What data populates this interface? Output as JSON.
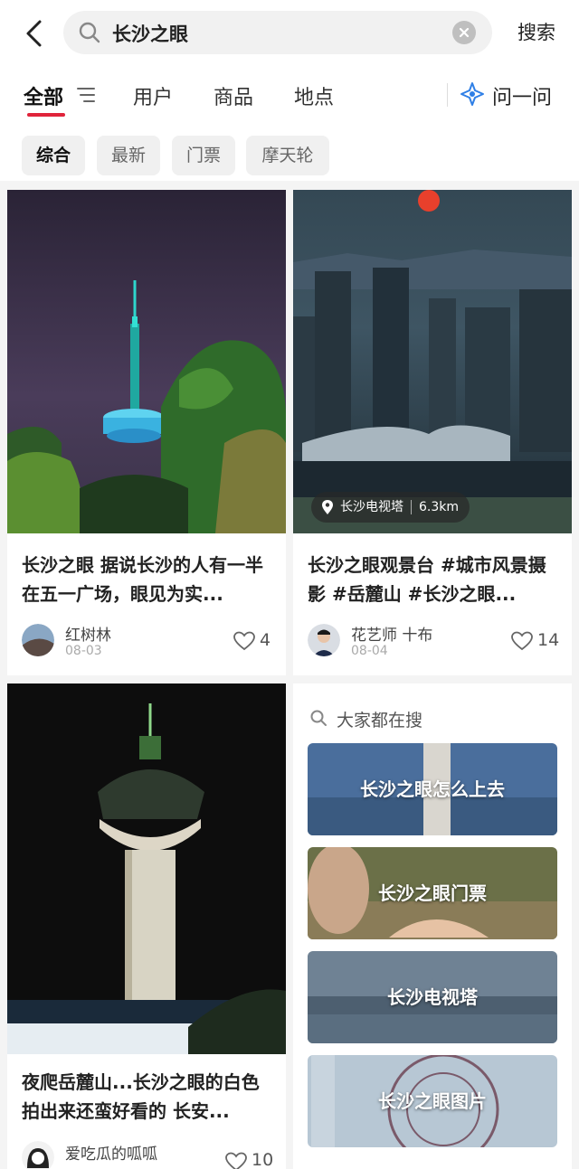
{
  "search": {
    "query": "长沙之眼",
    "submit_label": "搜索"
  },
  "tabs": [
    {
      "label": "全部",
      "active": true
    },
    {
      "label": "用户",
      "active": false
    },
    {
      "label": "商品",
      "active": false
    },
    {
      "label": "地点",
      "active": false
    }
  ],
  "ask": {
    "label": "问一问"
  },
  "chips": [
    {
      "label": "综合",
      "active": true
    },
    {
      "label": "最新",
      "active": false
    },
    {
      "label": "门票",
      "active": false
    },
    {
      "label": "摩天轮",
      "active": false
    }
  ],
  "posts": [
    {
      "title": "长沙之眼 据说长沙的人有一半在五一广场，眼见为实...",
      "author": "红树林",
      "date": "08-03",
      "likes": "4"
    },
    {
      "title": "长沙之眼观景台 #城市风景摄影 #岳麓山 #长沙之眼...",
      "author": "花艺师 十布",
      "date": "08-04",
      "likes": "14",
      "location": {
        "name": "长沙电视塔",
        "distance": "6.3km"
      }
    },
    {
      "title": "夜爬岳麓山...长沙之眼的白色拍出来还蛮好看的 长安...",
      "author": "爱吃瓜的呱呱",
      "likes": "10"
    }
  ],
  "suggestions": {
    "heading": "大家都在搜",
    "items": [
      {
        "label": "长沙之眼怎么上去"
      },
      {
        "label": "长沙之眼门票"
      },
      {
        "label": "长沙电视塔"
      },
      {
        "label": "长沙之眼图片"
      }
    ]
  },
  "colors": {
    "accent": "#e0233a",
    "ask_icon": "#2f7fe6"
  }
}
